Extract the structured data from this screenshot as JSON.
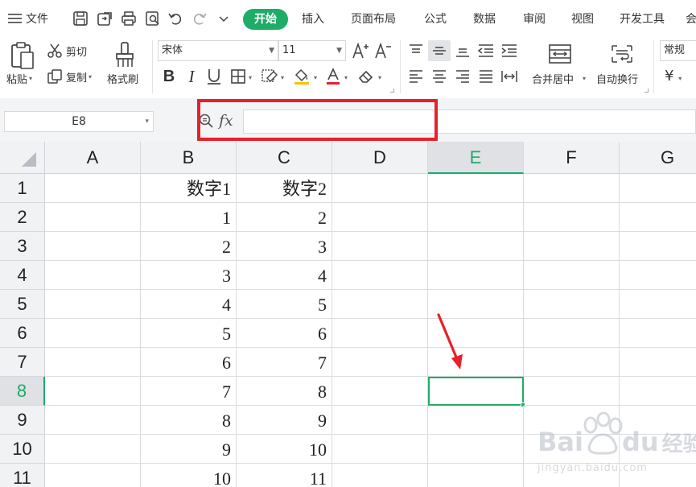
{
  "menubar": {
    "file_label": "文件",
    "tabs": [
      {
        "label": "开始",
        "active": true
      },
      {
        "label": "插入"
      },
      {
        "label": "页面布局"
      },
      {
        "label": "公式"
      },
      {
        "label": "数据"
      },
      {
        "label": "审阅"
      },
      {
        "label": "视图"
      },
      {
        "label": "开发工具"
      }
    ]
  },
  "ribbon": {
    "paste_label": "粘贴",
    "cut_label": "剪切",
    "copy_label": "复制",
    "format_painter_label": "格式刷",
    "font_name": "宋体",
    "font_size": "11",
    "merge_center_label": "合并居中",
    "wrap_text_label": "自动换行",
    "number_format": "常规",
    "currency_symbol": "¥"
  },
  "formula_bar": {
    "name_box": "E8",
    "fx_label": "fx",
    "value": ""
  },
  "sheet": {
    "columns": [
      "A",
      "B",
      "C",
      "D",
      "E",
      "F",
      "G"
    ],
    "active_column": "E",
    "active_row": "8",
    "rows": [
      {
        "num": "1",
        "B": "数字1",
        "C": "数字2"
      },
      {
        "num": "2",
        "B": "1",
        "C": "2"
      },
      {
        "num": "3",
        "B": "2",
        "C": "3"
      },
      {
        "num": "4",
        "B": "3",
        "C": "4"
      },
      {
        "num": "5",
        "B": "4",
        "C": "5"
      },
      {
        "num": "6",
        "B": "5",
        "C": "6"
      },
      {
        "num": "7",
        "B": "6",
        "C": "7"
      },
      {
        "num": "8",
        "B": "7",
        "C": "8"
      },
      {
        "num": "9",
        "B": "8",
        "C": "9"
      },
      {
        "num": "10",
        "B": "9",
        "C": "10"
      },
      {
        "num": "11",
        "B": "10",
        "C": "11"
      }
    ]
  },
  "watermark": {
    "brand": "Bai",
    "brand_suffix": "du",
    "product": "经验",
    "url": "jingyan.baidu.com"
  },
  "colors": {
    "accent": "#1eac67",
    "highlight_box": "#e8202a",
    "arrow": "#e8202a"
  }
}
